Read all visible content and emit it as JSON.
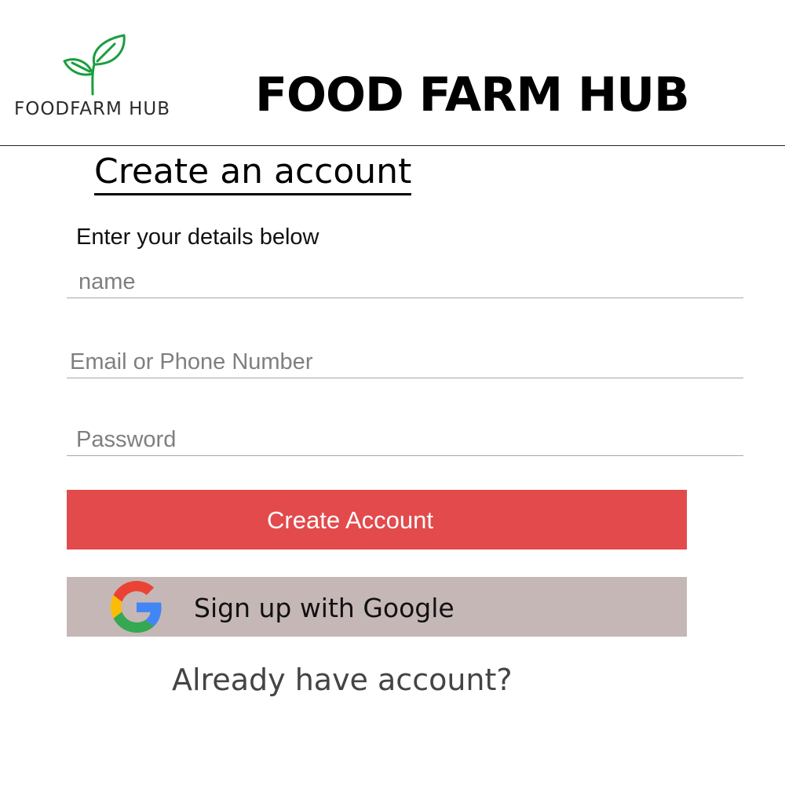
{
  "brand": {
    "logo_text": "FOODFARM HUB",
    "logo_icon": "leaf-sprout-icon",
    "title": "FOOD FARM HUB",
    "leaf_color": "#1a9e3f"
  },
  "form": {
    "title": "Create an account",
    "subtitle": "Enter your details below",
    "name_placeholder": "name",
    "email_placeholder": "Email or Phone Number",
    "password_placeholder": "Password",
    "create_button_label": "Create Account",
    "google_button_label": "Sign up with Google",
    "google_icon": "google-g-icon",
    "login_link": "Already have account?"
  },
  "colors": {
    "primary_button": "#e24a4c",
    "google_button": "#c5b7b6",
    "field_underline": "#a7a7a7"
  }
}
